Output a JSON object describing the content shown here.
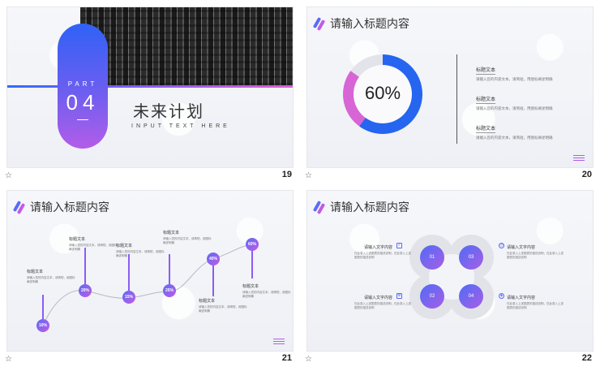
{
  "slides": [
    {
      "number": "19",
      "part": "PART",
      "part_num": "04",
      "title": "未来计划",
      "subtitle": "INPUT TEXT HERE"
    },
    {
      "number": "20",
      "title": "请输入标题内容",
      "percent": "60%",
      "items": [
        {
          "title": "标题文本",
          "desc": "请输入您的内容文本，请简短，用图标阐述明确"
        },
        {
          "title": "标题文本",
          "desc": "请输入您的内容文本，请简短，用图标阐述明确"
        },
        {
          "title": "标题文本",
          "desc": "请输入您的内容文本，请简短，用图标阐述明确"
        }
      ]
    },
    {
      "number": "21",
      "title": "请输入标题内容",
      "points": [
        {
          "pct": "10%",
          "label": "标题文本",
          "desc": "请输入您的内容文本，请简短，用图标阐述明确"
        },
        {
          "pct": "20%",
          "label": "标题文本",
          "desc": "请输入您的内容文本，请简短，用图标阐述明确"
        },
        {
          "pct": "15%",
          "label": "标题文本",
          "desc": "请输入您的内容文本，请简短，用图标阐述明确"
        },
        {
          "pct": "25%",
          "label": "标题文本",
          "desc": "请输入您的内容文本，请简短，用图标阐述明确"
        },
        {
          "pct": "40%",
          "label": "标题文本",
          "desc": "请输入您的内容文本，请简短，用图标阐述明确"
        },
        {
          "pct": "60%",
          "label": "标题文本",
          "desc": "请输入您的内容文本，请简短，用图标阐述明确"
        }
      ]
    },
    {
      "number": "22",
      "title": "请输入标题内容",
      "quads": [
        {
          "num": "01",
          "title": "请输入文字内容",
          "desc": "在此录入上述图表的描述说明，在此录入上述图表的描述说明"
        },
        {
          "num": "02",
          "title": "请输入文字内容",
          "desc": "在此录入上述图表的描述说明，在此录入上述图表的描述说明"
        },
        {
          "num": "03",
          "title": "请输入文字内容",
          "desc": "在此录入上述图表的描述说明，在此录入上述图表的描述说明"
        },
        {
          "num": "04",
          "title": "请输入文字内容",
          "desc": "在此录入上述图表的描述说明，在此录入上述图表的描述说明"
        }
      ]
    }
  ],
  "footer_icon": "star-icon",
  "colors": {
    "blue": "#2565f0",
    "pink": "#d765d6",
    "purple": "#8b5cf6"
  }
}
